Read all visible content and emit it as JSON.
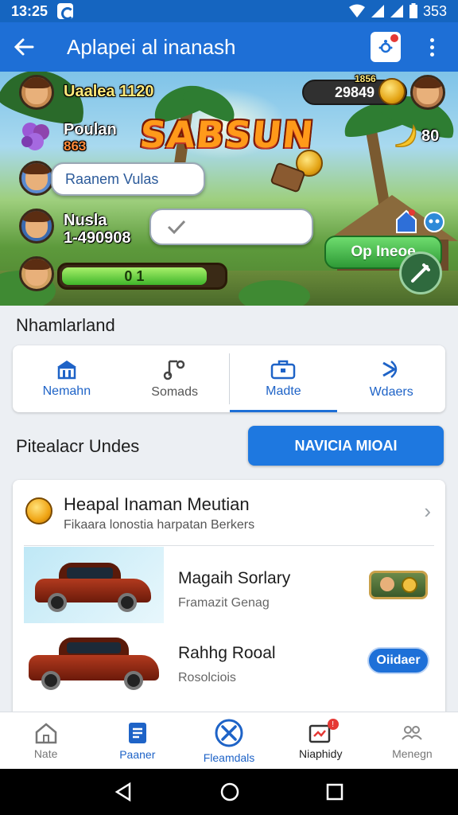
{
  "status_bar": {
    "time": "13:25",
    "battery": "353"
  },
  "app_bar": {
    "title": "Aplapei al inanash"
  },
  "game": {
    "player_name": "Uaalea 1120",
    "resource_label": "Poulan",
    "resource_value": "863",
    "logo_text": "SABSUN",
    "coin_level": "1856",
    "coin_value": "29849",
    "energy_value": "80",
    "search_placeholder": "Raanem Vulas",
    "green_button": "Op Ineoe",
    "rival_name": "Nusla",
    "rival_score": "1-490908",
    "progress_text": "0 1",
    "progress_fraction": 0.9
  },
  "section_title": "Nhamlarland",
  "quick_actions": [
    {
      "label": "Nemahn",
      "icon": "building-icon"
    },
    {
      "label": "Somads",
      "icon": "music-note-icon"
    },
    {
      "label": "Madte",
      "icon": "briefcase-icon"
    },
    {
      "label": "Wdaers",
      "icon": "share-icon"
    }
  ],
  "sub_section": {
    "title": "Pitealacr Undes",
    "button": "NAVICIA MIOAI"
  },
  "list": {
    "header_title": "Heapal Inaman Meutian",
    "header_sub": "Fikaara lonostia harpatan Berkers",
    "items": [
      {
        "title": "Magaih Sorlary",
        "subtitle": "Framazit Genag"
      },
      {
        "title": "Rahhg Rooal",
        "subtitle": "Rosolciois",
        "button": "Oiidaer"
      }
    ]
  },
  "bottom_nav": [
    {
      "label": "Nate",
      "icon": "home-icon"
    },
    {
      "label": "Paaner",
      "icon": "document-icon"
    },
    {
      "label": "Fleamdals",
      "icon": "tools-icon"
    },
    {
      "label": "Niaphidy",
      "icon": "mail-icon",
      "badge": "!"
    },
    {
      "label": "Menegn",
      "icon": "people-icon"
    }
  ],
  "colors": {
    "primary": "#1e6fd6",
    "status": "#1565c0",
    "accent_red": "#e53935"
  }
}
